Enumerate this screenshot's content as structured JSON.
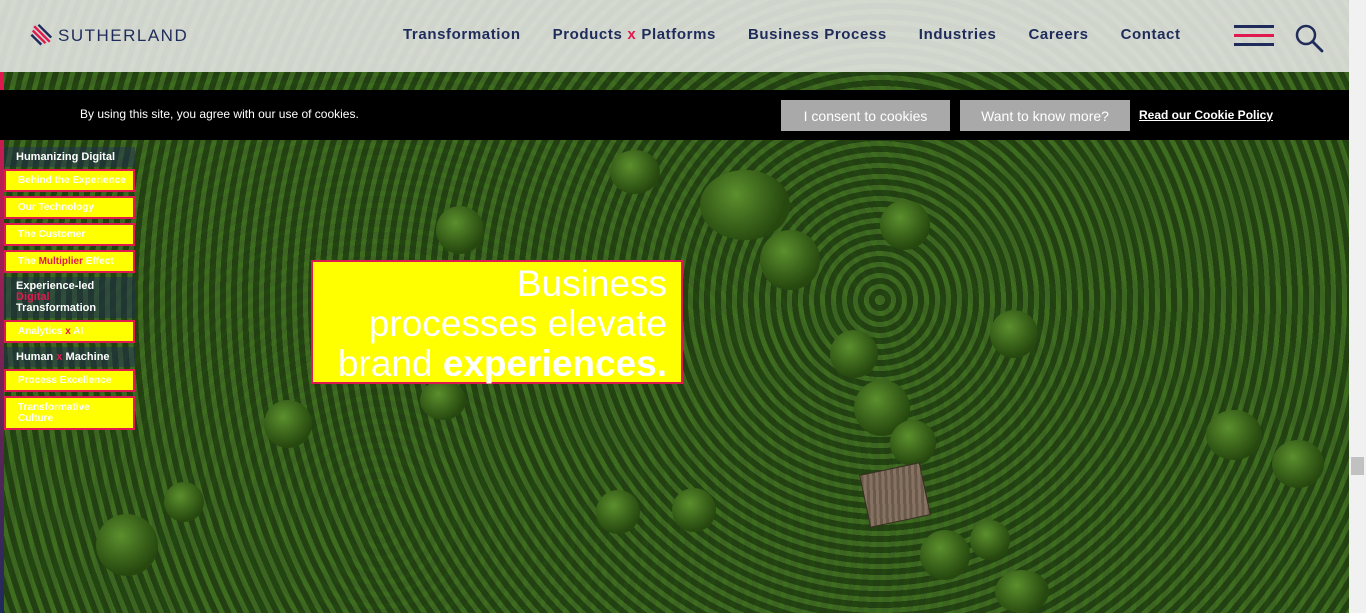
{
  "header": {
    "logo_text": "SUTHERLAND",
    "nav": [
      {
        "label": "Transformation"
      },
      {
        "label_a": "Products",
        "sep": "x",
        "label_b": "Platforms"
      },
      {
        "label": "Business Process"
      },
      {
        "label": "Industries"
      },
      {
        "label": "Careers"
      },
      {
        "label": "Contact"
      }
    ],
    "icons": [
      "menu-icon",
      "search-icon"
    ]
  },
  "cookie": {
    "text": "By using this site, you agree with our use of cookies.",
    "consent_label": "I consent to cookies",
    "more_label": "Want to know more?",
    "policy_link": "Read our Cookie Policy"
  },
  "sidemenu": {
    "section1": "Humanizing Digital",
    "item1": "Behind the Experience",
    "item2": "Our Technology",
    "item3": "The Customer",
    "item4_a": "The",
    "item4_b": "Multiplier",
    "item4_c": "Effect",
    "section2_a": "Experience-led",
    "section2_b": "Digital",
    "section2_c": "Transformation",
    "item5_a": "Analytics",
    "item5_b": "x",
    "item5_c": "AI",
    "section3_a": "Human",
    "section3_b": "x",
    "section3_c": "Machine",
    "item6": "Process Excellence",
    "item7": "Transformative Culture"
  },
  "hero": {
    "line1": "Business",
    "line2": "processes elevate",
    "line3_a": "brand",
    "line3_b": "experiences."
  },
  "colors": {
    "navy": "#1f2b5b",
    "accent": "#e0194f",
    "highlight": "#ffff00"
  }
}
